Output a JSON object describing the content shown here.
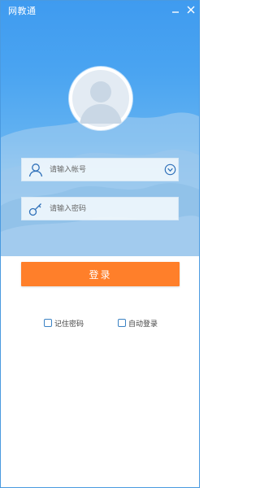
{
  "window": {
    "title": "网教通"
  },
  "login_form": {
    "account_placeholder": "请输入帐号",
    "password_placeholder": "请输入密码",
    "login_button_label": "登录"
  },
  "options": {
    "remember_password": "记住密码",
    "auto_login": "自动登录",
    "remember_checked": false,
    "auto_login_checked": false
  },
  "icons": {
    "avatar": "user-silhouette",
    "account": "person-icon",
    "password": "key-icon",
    "dropdown": "chevron-down-icon"
  },
  "colors": {
    "header_blue": "#3f9bf0",
    "login_button": "#ff7f2a",
    "checkbox_border": "#3b82c4"
  }
}
